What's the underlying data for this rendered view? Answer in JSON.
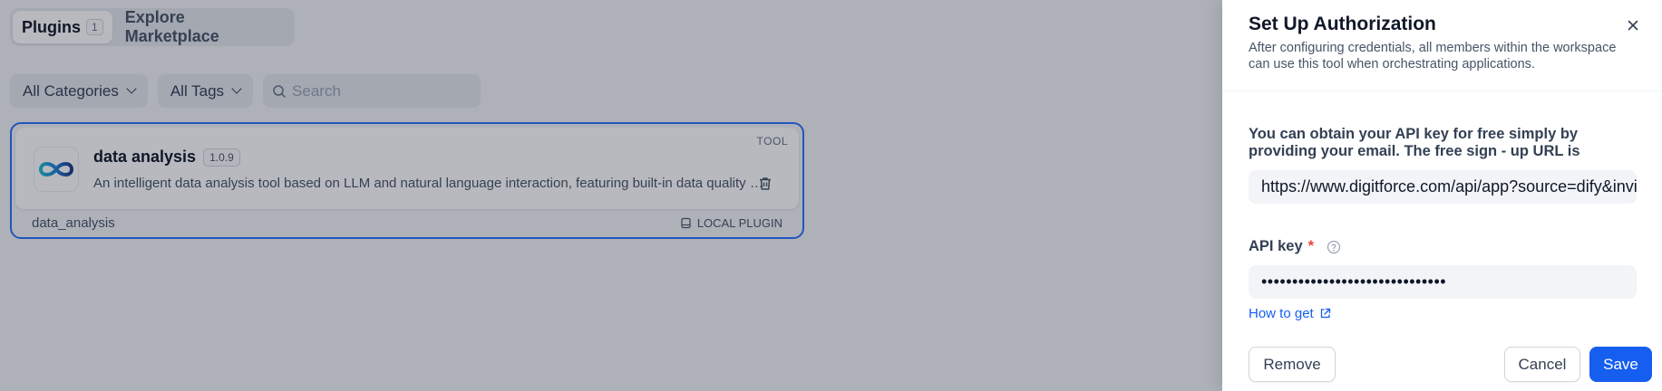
{
  "tabs": {
    "plugins_label": "Plugins",
    "plugins_count": "1",
    "marketplace_label": "Explore Marketplace"
  },
  "filters": {
    "categories": "All Categories",
    "tags": "All Tags",
    "search_placeholder": "Search"
  },
  "plugin_card": {
    "name": "data analysis",
    "version": "1.0.9",
    "type": "TOOL",
    "description": "An intelligent data analysis tool based on LLM and natural language interaction, featuring built-in data quality checks and visualization capabilities",
    "id": "data_analysis",
    "source": "LOCAL PLUGIN",
    "logo_icon": "infinity-logo-icon"
  },
  "panel": {
    "title": "Set Up Authorization",
    "subtitle": "After configuring credentials, all members within the workspace can use this tool when orchestrating applications.",
    "url_label": "You can obtain your API key for free simply by providing your email. The free sign - up URL is",
    "url_value": "https://www.digitforce.com/api/app?source=dify&invite=",
    "api_key_label": "API key",
    "required_mark": "*",
    "api_key_value": "••••••••••••••••••••••••••••••",
    "how_to_get": "How to get",
    "remove_label": "Remove",
    "cancel_label": "Cancel",
    "save_label": "Save"
  },
  "colors": {
    "accent": "#155eef",
    "selected_border": "#2970ff",
    "required": "#f04438"
  }
}
